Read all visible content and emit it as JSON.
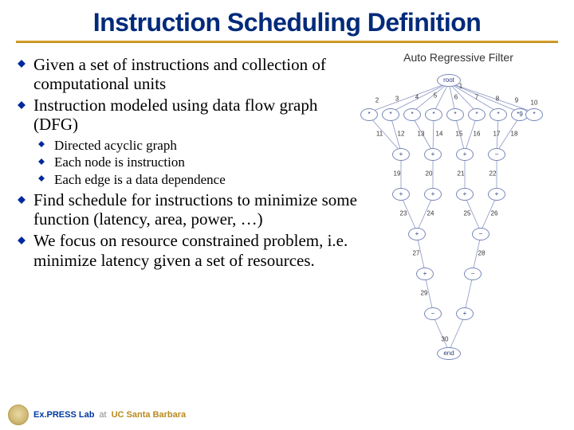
{
  "title": "Instruction Scheduling Definition",
  "right_title": "Auto Regressive Filter",
  "bullets": {
    "b1": "Given a set of instructions and collection of computational units",
    "b2": "Instruction modeled using data flow graph (DFG)",
    "sub1": "Directed acyclic graph",
    "sub2": "Each node is instruction",
    "sub3": "Each edge is a data dependence",
    "b3": "Find schedule for instructions to minimize some function (latency, area, power, …)",
    "b4": "We focus on resource constrained problem, i.e. minimize latency given a set of resources."
  },
  "footer": {
    "lab": "Ex.PRESS Lab",
    "at": "at",
    "org": "UC Santa Barbara"
  },
  "graph": {
    "root": "root",
    "end": "end",
    "op_mul": "*",
    "op_add": "+",
    "op_sub": "−",
    "edge_labels": [
      "1",
      "2",
      "3",
      "4",
      "5",
      "6",
      "7",
      "8",
      "9",
      "10",
      "11",
      "12",
      "13",
      "14",
      "15",
      "16",
      "17",
      "18",
      "19",
      "20",
      "21",
      "22",
      "23",
      "24",
      "25",
      "26",
      "27",
      "28",
      "29",
      "30"
    ],
    "node_ids": [
      "*9",
      "*"
    ]
  },
  "chart_data": {
    "type": "diagram",
    "title": "Auto Regressive Filter",
    "description": "Data flow graph (DAG) with a root node, 8 multiply (*) nodes in the first layer (edges labeled 2-10 from root, plus an extra *9 node on the right), followed by layers of add (+) and subtract (−) nodes with edges labeled 11-29, converging to a single end node via edge 30.",
    "nodes": [
      {
        "id": "root",
        "op": "root",
        "layer": 0
      },
      {
        "id": "m1",
        "op": "*",
        "layer": 1
      },
      {
        "id": "m2",
        "op": "*",
        "layer": 1
      },
      {
        "id": "m3",
        "op": "*",
        "layer": 1
      },
      {
        "id": "m4",
        "op": "*",
        "layer": 1
      },
      {
        "id": "m5",
        "op": "*",
        "layer": 1
      },
      {
        "id": "m6",
        "op": "*",
        "layer": 1
      },
      {
        "id": "m7",
        "op": "*",
        "layer": 1
      },
      {
        "id": "m8",
        "op": "*",
        "layer": 1
      },
      {
        "id": "m9",
        "op": "*9",
        "layer": 1
      },
      {
        "id": "a1",
        "op": "+",
        "layer": 2
      },
      {
        "id": "a2",
        "op": "+",
        "layer": 2
      },
      {
        "id": "a3",
        "op": "+",
        "layer": 2
      },
      {
        "id": "s1",
        "op": "-",
        "layer": 2
      },
      {
        "id": "a4",
        "op": "+",
        "layer": 3
      },
      {
        "id": "a5",
        "op": "+",
        "layer": 3
      },
      {
        "id": "a6",
        "op": "+",
        "layer": 3
      },
      {
        "id": "a7",
        "op": "+",
        "layer": 3
      },
      {
        "id": "a8",
        "op": "+",
        "layer": 4
      },
      {
        "id": "s2",
        "op": "-",
        "layer": 4
      },
      {
        "id": "a9",
        "op": "+",
        "layer": 5
      },
      {
        "id": "s3",
        "op": "-",
        "layer": 5
      },
      {
        "id": "s4",
        "op": "-",
        "layer": 6
      },
      {
        "id": "a10",
        "op": "+",
        "layer": 6
      },
      {
        "id": "end",
        "op": "end",
        "layer": 7
      }
    ],
    "edges_labeled": "1-30"
  }
}
